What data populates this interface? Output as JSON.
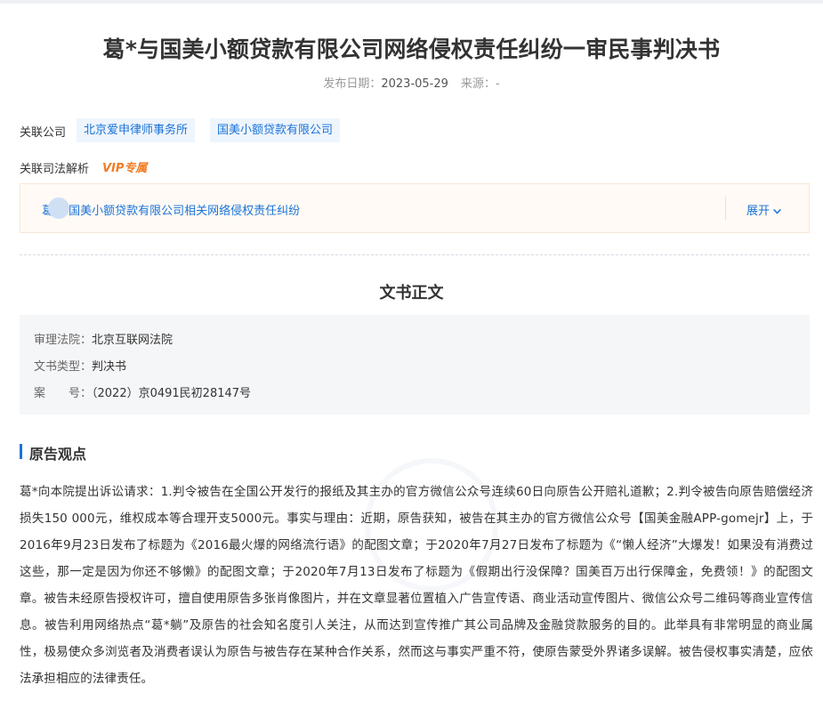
{
  "document": {
    "title": "葛*与国美小额贷款有限公司网络侵权责任纠纷一审民事判决书",
    "publish_label": "发布日期：",
    "publish_date": "2023-05-29",
    "source_label": "来源：",
    "source_value": "-"
  },
  "related": {
    "companies_label": "关联公司",
    "companies": [
      "北京爱申律师事务所",
      "国美小额贷款有限公司"
    ],
    "judicial_label": "关联司法解析",
    "vip_label": "VIP专属",
    "interpretation_link": "葛 与国美小额贷款有限公司相关网络侵权责任纠纷",
    "expand_label": "展开"
  },
  "doc_body": {
    "heading": "文书正文",
    "court_label": "审理法院：",
    "court_value": "北京互联网法院",
    "type_label": "文书类型：",
    "type_value": "判决书",
    "case_label": "案　　号：",
    "case_value": "（2022）京0491民初28147号"
  },
  "plaintiff_section": {
    "title": "原告观点",
    "text": "葛*向本院提出诉讼请求：1.判令被告在全国公开发行的报纸及其主办的官方微信公众号连续60日向原告公开赔礼道歉；2.判令被告向原告赔偿经济损失150 000元，维权成本等合理开支5000元。事实与理由：近期，原告获知，被告在其主办的官方微信公众号【国美金融APP-gomejr】上，于2016年9月23日发布了标题为《2016最火爆的网络流行语》的配图文章；于2020年7月27日发布了标题为《“懒人经济”大爆发！如果没有消费过这些，那一定是因为你还不够懒》的配图文章；于2020年7月13日发布了标题为《假期出行没保障？国美百万出行保障金，免费领！》的配图文章。被告未经原告授权许可，擅自使用原告多张肖像图片，并在文章显著位置植入广告宣传语、商业活动宣传图片、微信公众号二维码等商业宣传信息。被告利用网络热点“葛*躺”及原告的社会知名度引人关注，从而达到宣传推广其公司品牌及金融贷款服务的目的。此举具有非常明显的商业属性，极易使众多浏览者及消费者误认为原告与被告存在某种合作关系，然而这与事实严重不符，使原告蒙受外界诸多误解。被告侵权事实清楚，应依法承担相应的法律责任。"
  },
  "colors": {
    "link": "#1a73d8",
    "vip": "#f27b23",
    "section_bar": "#1a73d8"
  }
}
